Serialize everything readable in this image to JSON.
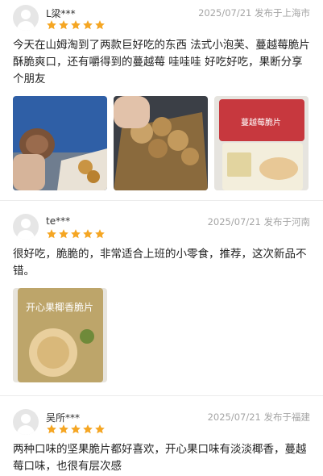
{
  "reviews": [
    {
      "username": "L梁***",
      "meta": "2025/07/21 发布于上海市",
      "rating": 5,
      "text": "今天在山姆淘到了两款巨好吃的东西  法式小泡芙、蔓越莓脆片  酥脆爽口，还有嚼得到的蔓越莓  哇哇哇  好吃好吃，果断分享个朋友",
      "photo_labels": [
        "",
        "",
        "蔓越莓脆片"
      ]
    },
    {
      "username": "te***",
      "meta": "2025/07/21 发布于河南",
      "rating": 5,
      "text": "很好吃，脆脆的，非常适合上班的小零食，推荐，这次新品不错。",
      "photo_labels": [
        "开心果椰香脆片"
      ]
    },
    {
      "username": "吴所***",
      "meta": "2025/07/21 发布于福建",
      "rating": 5,
      "text": "两种口味的坚果脆片都好喜欢，开心果口味有淡淡椰香，蔓越莓口味，也很有层次感"
    }
  ],
  "colors": {
    "star": "#f5a623",
    "meta": "#a5a5a5"
  }
}
